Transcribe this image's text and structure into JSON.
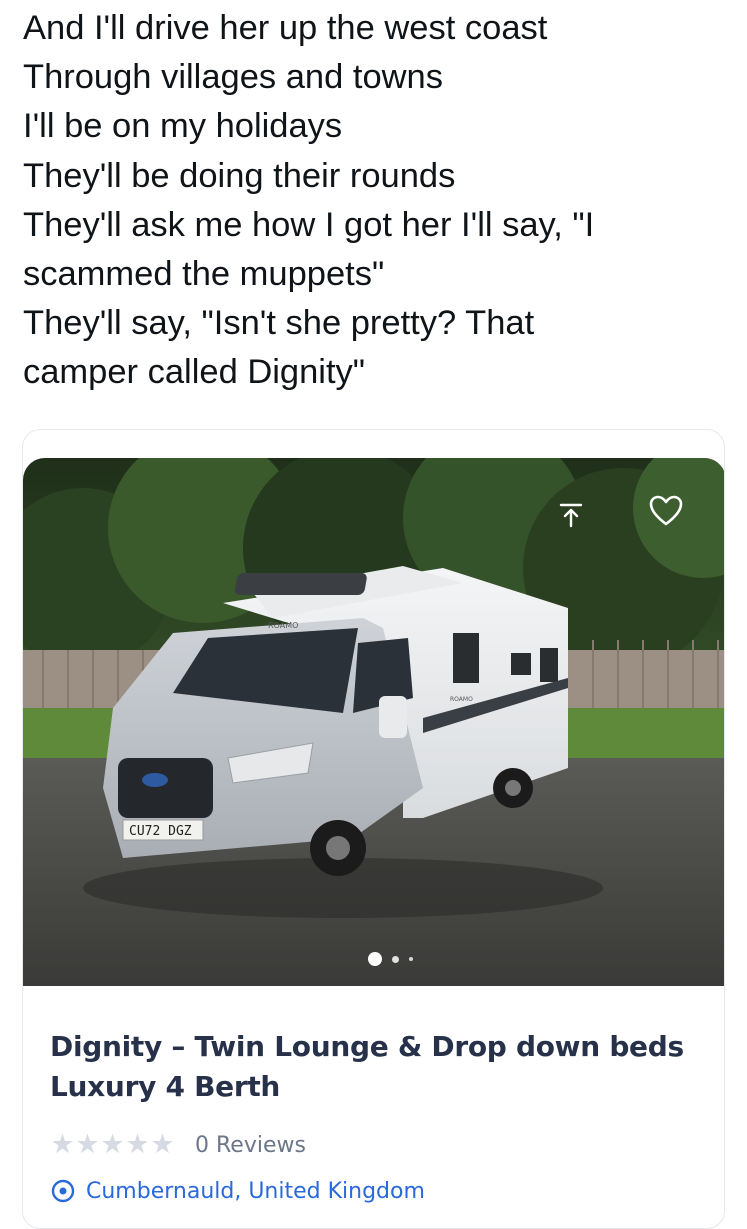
{
  "tweet": {
    "lines": [
      "And I'll drive her up the west coast",
      "Through villages and towns",
      "I'll be on my holidays",
      "They'll be doing their rounds",
      "They'll ask me how I got her I'll say, \"I",
      "scammed the muppets\"",
      "They'll say, \"Isn't she pretty? That",
      "camper called Dignity\""
    ]
  },
  "listing": {
    "title": "Dignity – Twin Lounge & Drop down beds Luxury 4 Berth",
    "rating_stars": 0,
    "reviews_label": "0 Reviews",
    "location": "Cumbernauld, United Kingdom",
    "photo": {
      "plate": "CU72 DGZ",
      "brand_badge": "ROAMO",
      "side_badge": "ROAMO",
      "current_slide": 1,
      "slide_count": 3
    },
    "icons": {
      "share": "share-icon",
      "favorite": "heart-icon",
      "location": "location-pin-icon",
      "star": "star-icon"
    },
    "colors": {
      "title": "#27324a",
      "link": "#2a69d9",
      "star_empty": "#d6dbe3",
      "muted": "#6c7689"
    }
  }
}
